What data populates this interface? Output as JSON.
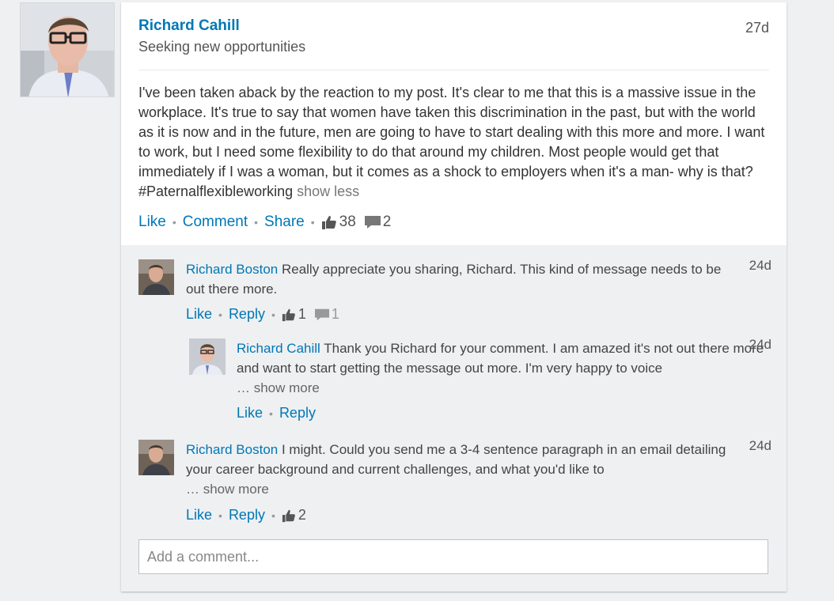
{
  "post": {
    "author": "Richard Cahill",
    "headline": "Seeking new opportunities",
    "time": "27d",
    "body": "I've been taken aback by the reaction to my post. It's clear to me that this is a massive issue in the workplace. It's true to say that women have taken this discrimination in the past, but with the world as it is now and in the future, men are going to have to start dealing with this more and more. I want to work, but I need some flexibility to do that around my children. Most people would get that immediately if I was a woman, but it comes as a shock to employers when it's a man- why is that? #Paternalflexibleworking",
    "show_less": "show less",
    "actions": {
      "like": "Like",
      "comment": "Comment",
      "share": "Share",
      "likes": "38",
      "comments": "2"
    }
  },
  "comments": [
    {
      "author": "Richard Boston",
      "text": "Really appreciate you sharing, Richard. This kind of message needs to be out there more.",
      "time": "24d",
      "actions": {
        "like": "Like",
        "reply": "Reply",
        "likes": "1",
        "replies": "1"
      }
    },
    {
      "author": "Richard Cahill",
      "text": "Thank you Richard for your comment. I am amazed it's not out there more and want to start getting the message out more. I'm very happy to voice",
      "show_more": "… show more",
      "time": "24d",
      "actions": {
        "like": "Like",
        "reply": "Reply"
      }
    },
    {
      "author": "Richard Boston",
      "text": "I might. Could you send me a 3-4 sentence paragraph in an email detailing your career background and current challenges, and what you'd like to",
      "show_more": "… show more",
      "time": "24d",
      "actions": {
        "like": "Like",
        "reply": "Reply",
        "likes": "2"
      }
    }
  ],
  "add_comment": {
    "placeholder": "Add a comment..."
  },
  "icons": {
    "like": "thumbs-up-icon",
    "comment": "speech-bubble-icon"
  },
  "colors": {
    "link": "#0077b5",
    "background": "#eef0f2"
  }
}
